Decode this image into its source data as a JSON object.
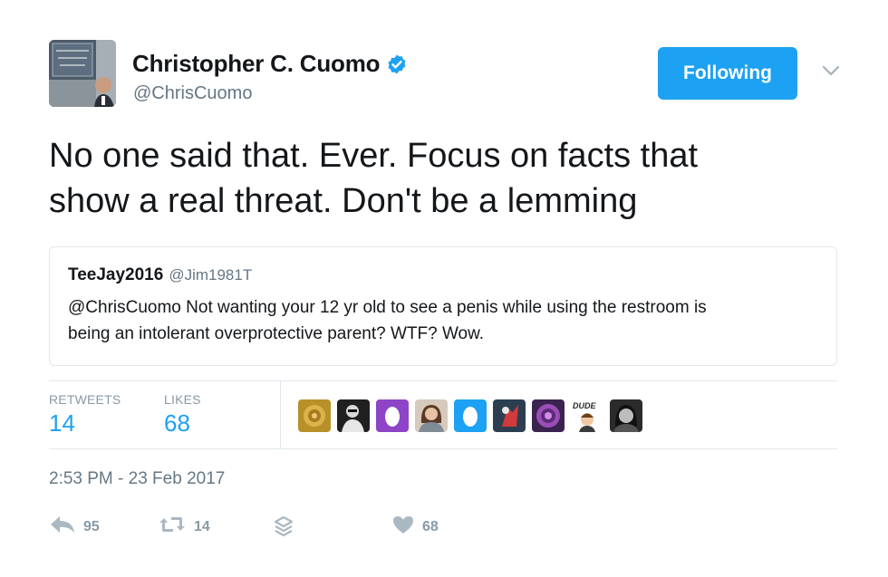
{
  "author": {
    "name": "Christopher C. Cuomo",
    "handle": "@ChrisCuomo",
    "verified": true
  },
  "follow_button": {
    "label": "Following",
    "color": "#1da1f2"
  },
  "tweet": {
    "text_line1": "No one said that. Ever. Focus on facts that",
    "text_line2": "show a real threat. Don't be a lemming"
  },
  "quoted_tweet": {
    "name": "TeeJay2016",
    "handle": "@Jim1981T",
    "text_line1": "@ChrisCuomo Not wanting your 12 yr old to see a penis while using the restroom is",
    "text_line2": "being an intolerant overprotective parent? WTF? Wow."
  },
  "stats": {
    "retweets_label": "RETWEETS",
    "retweets_value": "14",
    "likes_label": "LIKES",
    "likes_value": "68"
  },
  "likers": [
    {
      "icon": "avatar-gold-pattern",
      "color": "#b8902a"
    },
    {
      "icon": "avatar-man-dark",
      "color": "#202020"
    },
    {
      "icon": "egg-purple",
      "color": "#8e44c7"
    },
    {
      "icon": "avatar-woman",
      "color": "#c9b9a8"
    },
    {
      "icon": "egg-blue",
      "color": "#1da1f2"
    },
    {
      "icon": "avatar-red-figure",
      "color": "#3a4a5c"
    },
    {
      "icon": "avatar-purple-circle",
      "color": "#4a2c5e"
    },
    {
      "icon": "avatar-bitmoji",
      "color": "#f4f4f4",
      "text": "DUDE"
    },
    {
      "icon": "avatar-face-dark",
      "color": "#2b2b2b"
    }
  ],
  "timestamp": "2:53 PM - 23 Feb 2017",
  "actions": {
    "reply_count": "95",
    "retweet_count": "14",
    "like_count": "68"
  },
  "colors": {
    "link_blue": "#1da1f2",
    "muted": "#8899a6",
    "border": "#e1e8ed"
  }
}
